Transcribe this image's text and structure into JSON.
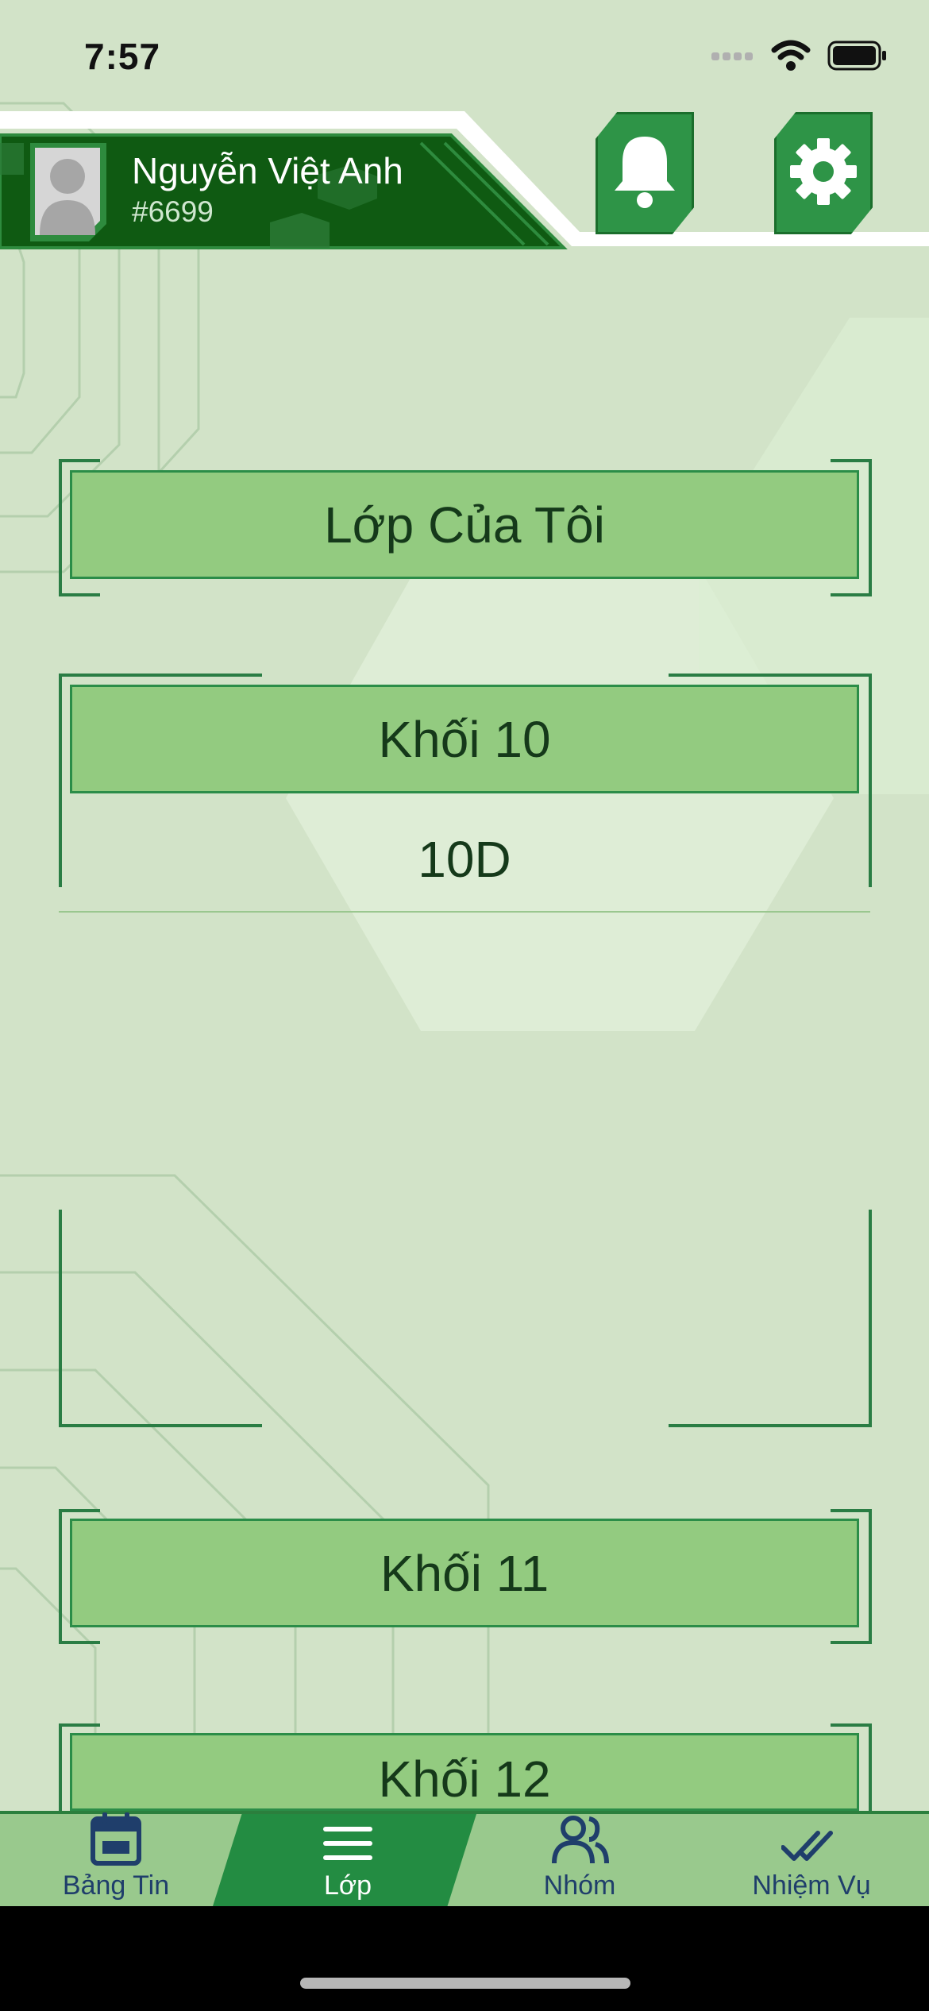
{
  "status": {
    "time": "7:57"
  },
  "user": {
    "name": "Nguyễn Việt Anh",
    "id": "#6699"
  },
  "header": {
    "bell_icon": "bell-icon",
    "settings_icon": "gear-icon"
  },
  "sections": {
    "my_class": "Lớp Của Tôi",
    "grade10": {
      "label": "Khối 10",
      "classes": [
        "10D"
      ]
    },
    "grade11": "Khối 11",
    "grade12": "Khối 12"
  },
  "tabs": [
    {
      "label": "Bảng Tin",
      "icon": "calendar-icon"
    },
    {
      "label": "Lớp",
      "icon": "menu-icon",
      "active": true
    },
    {
      "label": "Nhóm",
      "icon": "group-icon"
    },
    {
      "label": "Nhiệm Vụ",
      "icon": "double-check-icon"
    }
  ],
  "colors": {
    "background": "#d2e3c8",
    "header": "#0f5a12",
    "button": "#93cb80",
    "accent": "#238c42"
  }
}
